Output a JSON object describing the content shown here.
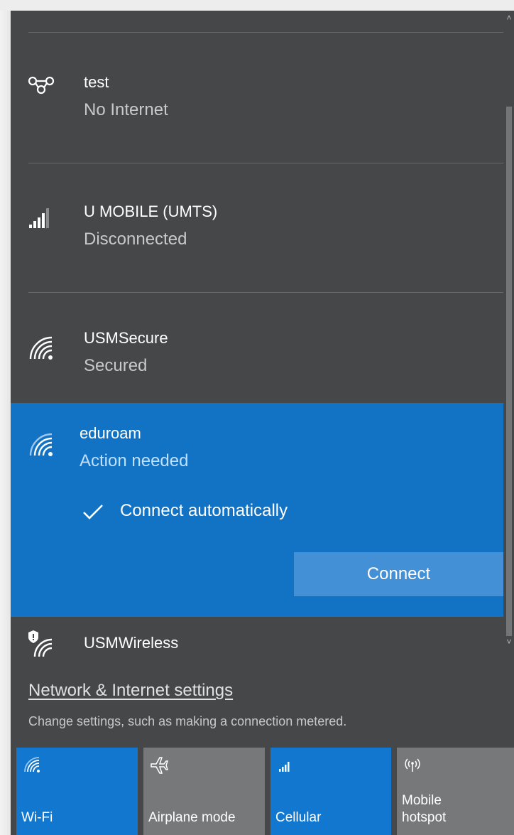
{
  "networks": [
    {
      "name": "test",
      "status": "No Internet",
      "icon": "mobile-hotspot-link-icon"
    },
    {
      "name": "U MOBILE (UMTS)",
      "status": "Disconnected",
      "icon": "cellular-signal-icon"
    },
    {
      "name": "USMSecure",
      "status": "Secured",
      "icon": "wifi-secured-icon"
    },
    {
      "name": "eduroam",
      "status": "Action needed",
      "icon": "wifi-icon"
    },
    {
      "name": "USMWireless",
      "status": "",
      "icon": "wifi-shield-icon"
    }
  ],
  "selected": {
    "connect_automatically_label": "Connect automatically",
    "connect_automatically_checked": true,
    "connect_button": "Connect"
  },
  "settings": {
    "link": "Network & Internet settings",
    "description": "Change settings, such as making a connection metered."
  },
  "quick_actions": [
    {
      "label": "Wi-Fi",
      "active": true,
      "icon": "wifi-icon"
    },
    {
      "label": "Airplane mode",
      "active": false,
      "icon": "airplane-icon"
    },
    {
      "label": "Cellular",
      "active": true,
      "icon": "cellular-signal-icon"
    },
    {
      "label": "Mobile\nhotspot",
      "label_line1": "Mobile",
      "label_line2": "hotspot",
      "active": false,
      "icon": "hotspot-icon"
    }
  ],
  "colors": {
    "panel_bg": "#464749",
    "accent": "#1272c4",
    "tile_active": "#1277cf",
    "tile_inactive": "#77787a"
  }
}
